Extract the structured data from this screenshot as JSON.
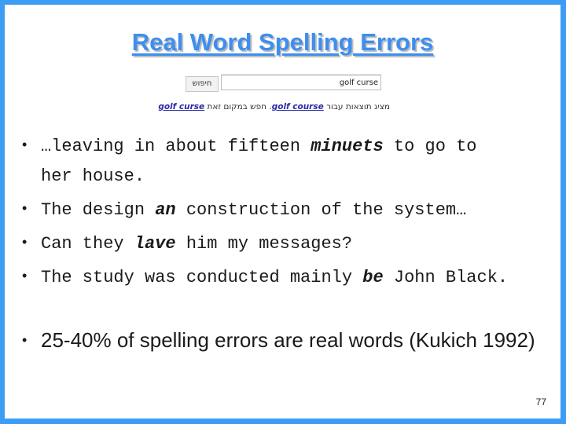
{
  "slide": {
    "title": "Real Word Spelling Errors",
    "google_screenshot": {
      "search_button_label": "חיפוש",
      "search_input_value": "golf curse",
      "suggestion_prefix": "מציג תוצאות עבור ",
      "suggestion_corrected": "golf course",
      "suggestion_middle": ". חפש במקום זאת ",
      "suggestion_original": "golf curse"
    },
    "examples": [
      {
        "before": "…leaving in about fifteen ",
        "error": "minuets",
        "after": " to go to",
        "continuation": "her house."
      },
      {
        "before": "The design ",
        "error": "an",
        "after": " construction of the system…"
      },
      {
        "before": "Can they ",
        "error": "lave",
        "after": " him my messages?"
      },
      {
        "before": "The study was conducted mainly ",
        "error": "be",
        "after": " John Black."
      }
    ],
    "statistic": "25-40% of spelling errors are real words  (Kukich 1992)",
    "bullet_symbol": "•",
    "page_number": "77"
  },
  "colors": {
    "border": "#3d9df5",
    "title": "#3d8ef0",
    "link": "#2a2aa8"
  }
}
